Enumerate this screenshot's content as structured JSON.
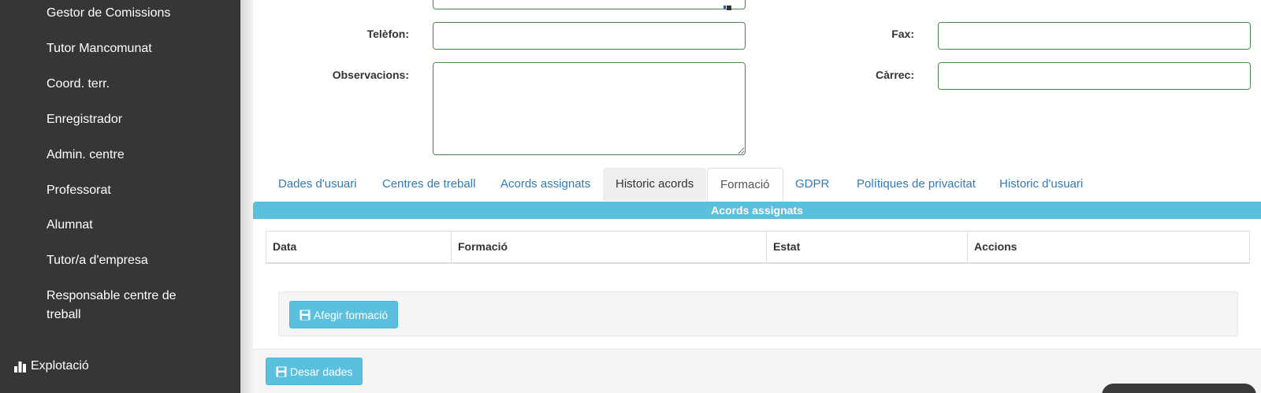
{
  "sidebar": {
    "items": [
      {
        "label": "Gestor de Comissions"
      },
      {
        "label": "Tutor Mancomunat"
      },
      {
        "label": "Coord. terr."
      },
      {
        "label": "Enregistrador"
      },
      {
        "label": "Admin. centre"
      },
      {
        "label": "Professorat"
      },
      {
        "label": "Alumnat"
      },
      {
        "label": "Tutor/a d'empresa"
      },
      {
        "label": "Responsable centre de treball"
      }
    ],
    "section": {
      "label": "Explotació",
      "icon": "bar-chart-icon"
    }
  },
  "form": {
    "telefon_label": "Telèfon:",
    "telefon_value": "",
    "fax_label": "Fax:",
    "fax_value": "",
    "observacions_label": "Observacions:",
    "observacions_value": "",
    "carrec_label": "Càrrec:",
    "carrec_value": ""
  },
  "tabs": [
    {
      "label": "Dades d'usuari"
    },
    {
      "label": "Centres de treball"
    },
    {
      "label": "Acords assignats"
    },
    {
      "label": "Historic acords"
    },
    {
      "label": "Formació"
    },
    {
      "label": "GDPR"
    },
    {
      "label": "Polítiques de privacitat"
    },
    {
      "label": "Historic d'usuari"
    }
  ],
  "panel": {
    "title": "Acords assignats",
    "columns": [
      "Data",
      "Formació",
      "Estat",
      "Accions"
    ]
  },
  "buttons": {
    "add_training": "Afegir formació",
    "save": "Desar dades"
  },
  "colors": {
    "sidebar_bg": "#363636",
    "accent": "#5bc0de",
    "link": "#337ab7",
    "input_border": "#4a8a4a"
  }
}
